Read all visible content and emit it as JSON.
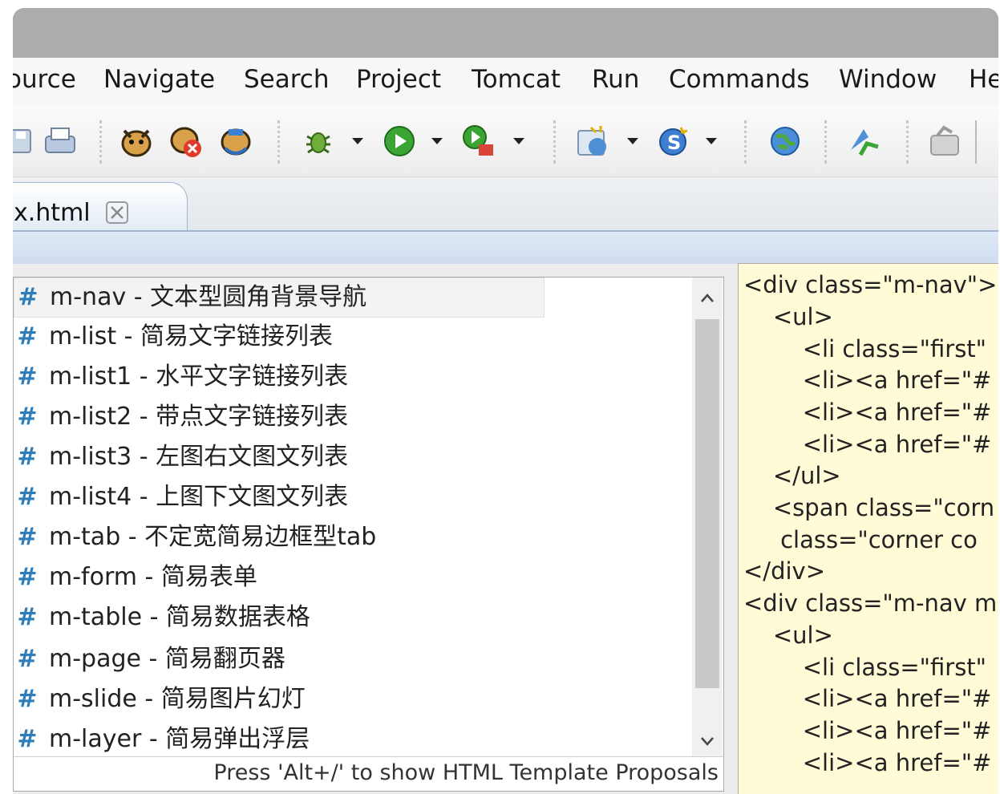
{
  "menubar": {
    "items": [
      "ource",
      "Navigate",
      "Search",
      "Project",
      "Tomcat",
      "Run",
      "Commands",
      "Window",
      "He"
    ]
  },
  "toolbar": {
    "icons": [
      "save-all-icon",
      "print-icon",
      "tomcat-start-icon",
      "tomcat-stop-icon",
      "tomcat-restart-icon",
      "debug-icon",
      "run-icon",
      "external-tools-icon",
      "new-web-project-icon",
      "new-service-icon",
      "open-browser-icon",
      "deploy-icon",
      "open-task-icon"
    ]
  },
  "editor": {
    "tab_label": "x.html"
  },
  "proposals": {
    "items": [
      {
        "hash": "#",
        "text": "m-nav - 文本型圆角背景导航"
      },
      {
        "hash": "#",
        "text": "m-list - 简易文字链接列表"
      },
      {
        "hash": "#",
        "text": "m-list1 - 水平文字链接列表"
      },
      {
        "hash": "#",
        "text": "m-list2 - 带点文字链接列表"
      },
      {
        "hash": "#",
        "text": "m-list3 - 左图右文图文列表"
      },
      {
        "hash": "#",
        "text": "m-list4 - 上图下文图文列表"
      },
      {
        "hash": "#",
        "text": "m-tab - 不定宽简易边框型tab"
      },
      {
        "hash": "#",
        "text": "m-form - 简易表单"
      },
      {
        "hash": "#",
        "text": "m-table - 简易数据表格"
      },
      {
        "hash": "#",
        "text": "m-page - 简易翻页器"
      },
      {
        "hash": "#",
        "text": "m-slide - 简易图片幻灯"
      },
      {
        "hash": "#",
        "text": "m-layer - 简易弹出浮层"
      }
    ],
    "status": "Press 'Alt+/' to show HTML Template Proposals"
  },
  "template_preview": {
    "lines": [
      "<div class=\"m-nav\">",
      "    <ul>",
      "        <li class=\"first\"",
      "        <li><a href=\"#",
      "        <li><a href=\"#",
      "        <li><a href=\"#",
      "    </ul>",
      "    <span class=\"corn",
      "     class=\"corner co",
      "</div>",
      "<div class=\"m-nav m",
      "    <ul>",
      "        <li class=\"first\"",
      "        <li><a href=\"#",
      "        <li><a href=\"#",
      "        <li><a href=\"#"
    ]
  }
}
